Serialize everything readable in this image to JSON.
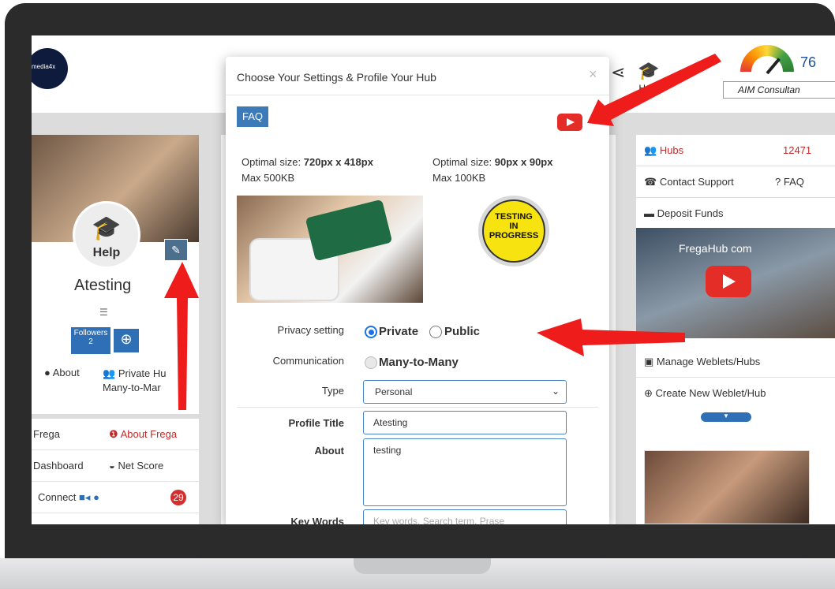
{
  "colors": {
    "accent": "#2e6fb5",
    "arrow": "#ef1c1c",
    "badge": "#d32f2f",
    "youtube": "#e52d27"
  },
  "topbar": {
    "logo_text": "media4x",
    "share_icon": "share-icon",
    "help_label": "Help",
    "score": "76",
    "aim_label": "AIM Consultan"
  },
  "left_card": {
    "help_label": "Help",
    "name": "Atesting",
    "followers_label": "Followers",
    "followers_count": "2",
    "about_label": "About",
    "private_hub_line1": "Private Hu",
    "private_hub_line2": "Many-to-Mar"
  },
  "left_menu": {
    "frega": "Frega",
    "about_frega": "About Frega",
    "dashboard": "Dashboard",
    "net_score": "Net Score",
    "connect": "Connect",
    "connect_badge": "29"
  },
  "right_panel": {
    "hubs_label": "Hubs",
    "hubs_count": "12471",
    "contact_support": "Contact Support",
    "faq": "FAQ",
    "deposit_funds": "Deposit Funds",
    "video_title": "FregaHub com",
    "manage": "Manage Weblets/Hubs",
    "create": "Create New Weblet/Hub"
  },
  "modal": {
    "title": "Choose Your Settings & Profile Your Hub",
    "close": "×",
    "faq_button": "FAQ",
    "cover": {
      "optimal_prefix": "Optimal size: ",
      "optimal_value": "720px x 418px",
      "max": "Max 500KB"
    },
    "avatar": {
      "optimal_prefix": "Optimal size: ",
      "optimal_value": "90px x 90px",
      "max": "Max 100KB"
    },
    "badge_lines": [
      "TESTING",
      "IN",
      "PROGRESS"
    ],
    "privacy_label": "Privacy setting",
    "privacy_options": [
      "Private",
      "Public"
    ],
    "privacy_selected": "Private",
    "communication_label": "Communication",
    "communication_value": "Many-to-Many",
    "type_label": "Type",
    "type_value": "Personal",
    "profile_title_label": "Profile Title",
    "profile_title_value": "Atesting",
    "about_label": "About",
    "about_value": "testing",
    "keywords_label": "Key Words",
    "keywords_placeholder": "Key words, Search term, Prase"
  }
}
